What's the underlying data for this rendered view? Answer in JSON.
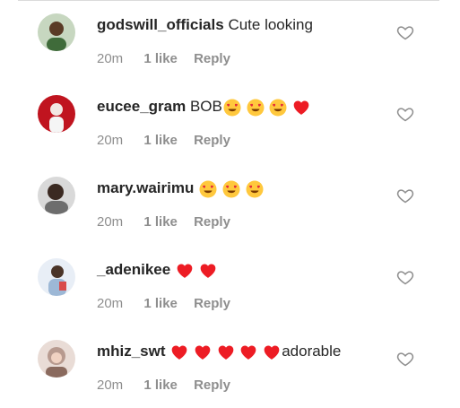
{
  "comments": [
    {
      "username": "godswill_officials",
      "text": "Cute looking",
      "emojis": [],
      "suffix": "",
      "time": "20m",
      "likes": "1 like",
      "reply": "Reply",
      "avatar_color": "#3f6b3a"
    },
    {
      "username": "eucee_gram",
      "text": "BOB",
      "emojis": [
        "heart-eyes",
        "heart-eyes",
        "heart-eyes",
        "red-heart"
      ],
      "suffix": "",
      "time": "20m",
      "likes": "1 like",
      "reply": "Reply",
      "avatar_color": "#c0141f"
    },
    {
      "username": "mary.wairimu",
      "text": "",
      "emojis": [
        "heart-eyes",
        "heart-eyes",
        "heart-eyes"
      ],
      "suffix": "",
      "time": "20m",
      "likes": "1 like",
      "reply": "Reply",
      "avatar_color": "#6d6d6d"
    },
    {
      "username": "_adenikee",
      "text": "",
      "emojis": [
        "red-heart",
        "red-heart"
      ],
      "suffix": "",
      "time": "20m",
      "likes": "1 like",
      "reply": "Reply",
      "avatar_color": "#9db8d6"
    },
    {
      "username": "mhiz_swt",
      "text": "",
      "emojis": [
        "red-heart",
        "red-heart",
        "red-heart",
        "red-heart",
        "red-heart"
      ],
      "suffix": "adorable",
      "time": "20m",
      "likes": "1 like",
      "reply": "Reply",
      "avatar_color": "#b79a8f"
    }
  ],
  "colors": {
    "text": "#262626",
    "meta": "#8e8e8e",
    "heart": "#ed1c24",
    "emoji_face": "#ffc83d",
    "divider": "#dbdbdb"
  }
}
